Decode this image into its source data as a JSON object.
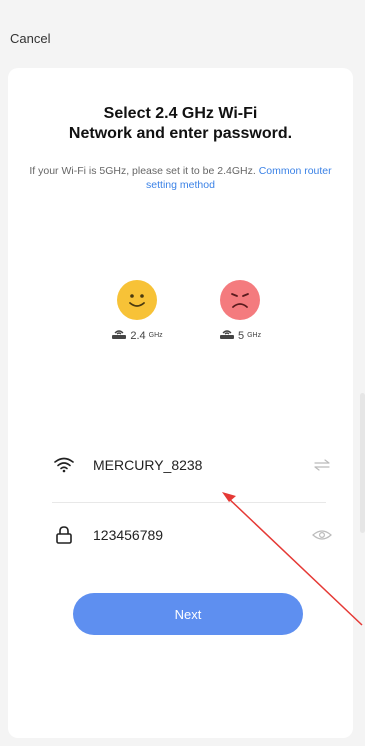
{
  "header": {
    "cancel_label": "Cancel"
  },
  "card": {
    "title_line1": "Select 2.4 GHz Wi-Fi",
    "title_line2": "Network and enter password.",
    "subtitle_text": "If your Wi-Fi is 5GHz, please set it to be 2.4GHz.",
    "subtitle_link": "Common router setting method"
  },
  "bands": [
    {
      "icon": "smile-face-icon",
      "value": "2.4",
      "unit": "GHz",
      "color": "#f7c237"
    },
    {
      "icon": "sad-face-icon",
      "value": "5",
      "unit": "GHz",
      "color": "#f47b7e"
    }
  ],
  "wifi": {
    "ssid": "MERCURY_8238",
    "password": "123456789"
  },
  "next_label": "Next",
  "colors": {
    "accent": "#5e8ff0",
    "link": "#3b82e6",
    "annotation_arrow": "#e53935"
  }
}
